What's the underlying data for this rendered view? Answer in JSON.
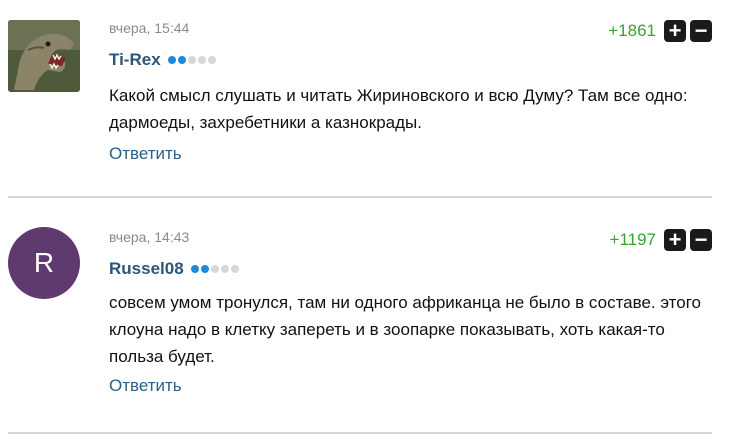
{
  "comments": [
    {
      "timestamp": "вчера, 15:44",
      "author": "Ti-Rex",
      "level_of_5": 2,
      "score": "+1861",
      "text": "Какой смысл слушать и читать Жириновского и всю Думу? Там все одно: дармоеды, захребетники а казнокрады.",
      "reply_label": "Ответить",
      "avatar": "dinosaur-photo"
    },
    {
      "timestamp": "вчера, 14:43",
      "author": "Russel08",
      "level_of_5": 2,
      "score": "+1197",
      "text": "совсем умом тронулся, там ни одного африканца не было в составе. этого клоуна надо в клетку запереть и в зоопарке показывать, хоть какая-то польза будет.",
      "reply_label": "Ответить",
      "avatar_letter": "R"
    }
  ],
  "vote": {
    "up_symbol": "+",
    "down_symbol": "−"
  },
  "colors": {
    "author": "#2c5577",
    "score": "#38a32f",
    "reply": "#2c6086",
    "avatar_bg": "#5e3a6e",
    "level_on": "#1e88d6"
  }
}
